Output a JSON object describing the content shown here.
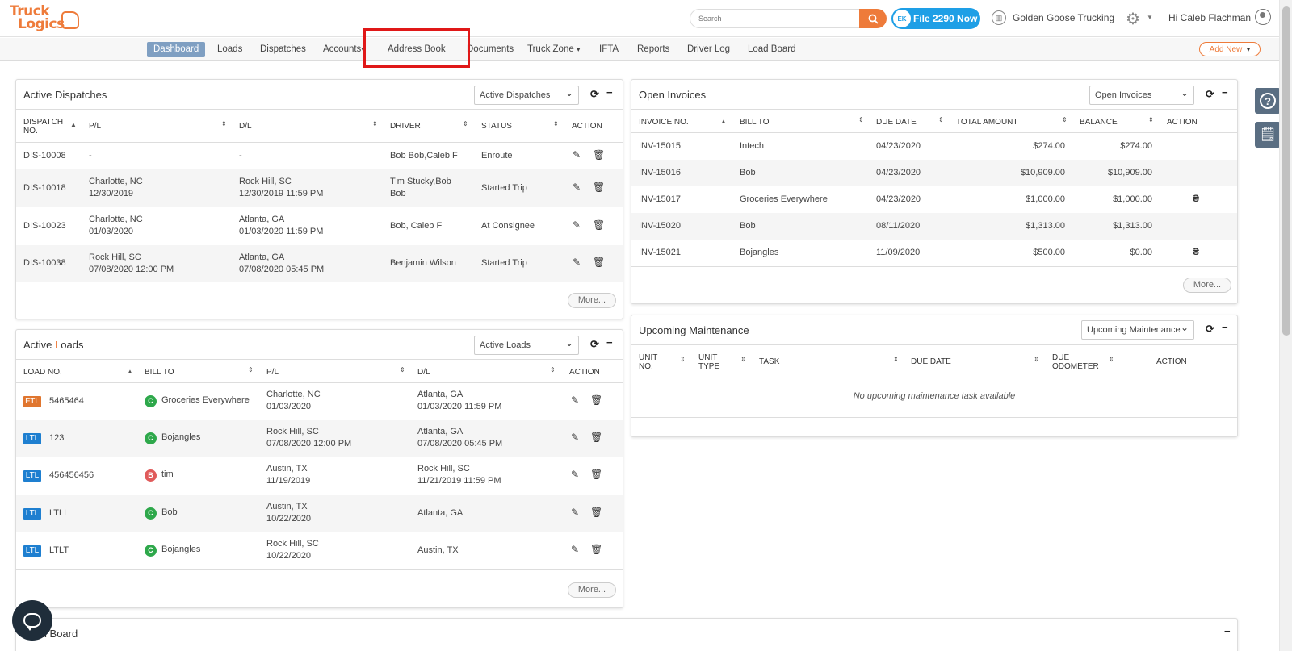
{
  "header": {
    "logo_line1": "Truck",
    "logo_line2": "Logics",
    "search_placeholder": "Search",
    "file_badge": "EK",
    "file_button": "File 2290 Now",
    "company": "Golden Goose Trucking",
    "greeting": "Hi Caleb Flachman"
  },
  "nav": {
    "items": [
      "Dashboard",
      "Loads",
      "Dispatches",
      "Accounts",
      "Address Book",
      "Documents",
      "Truck Zone",
      "IFTA",
      "Reports",
      "Driver Log",
      "Load Board"
    ],
    "accounts_caret": "▾",
    "truckzone_caret": "▾",
    "add_new": "Add New",
    "add_new_caret": "▾"
  },
  "dispatches": {
    "title": "Active Dispatches",
    "select": "Active Dispatches",
    "columns": [
      "DISPATCH",
      "NO.",
      "P/L",
      "D/L",
      "DRIVER",
      "STATUS",
      "ACTION"
    ],
    "rows": [
      {
        "no": "DIS-10008",
        "pl1": "-",
        "pl2": "",
        "dl1": "-",
        "dl2": "",
        "driver1": "Bob Bob,Caleb F",
        "driver2": "",
        "status": "Enroute"
      },
      {
        "no": "DIS-10018",
        "pl1": "Charlotte, NC",
        "pl2": "12/30/2019",
        "dl1": "Rock Hill, SC",
        "dl2": "12/30/2019 11:59 PM",
        "driver1": "Tim Stucky,Bob",
        "driver2": "Bob",
        "status": "Started Trip"
      },
      {
        "no": "DIS-10023",
        "pl1": "Charlotte, NC",
        "pl2": "01/03/2020",
        "dl1": "Atlanta, GA",
        "dl2": "01/03/2020 11:59 PM",
        "driver1": "Bob, Caleb F",
        "driver2": "",
        "status": "At Consignee"
      },
      {
        "no": "DIS-10038",
        "pl1": "Rock Hill, SC",
        "pl2": "07/08/2020 12:00 PM",
        "dl1": "Atlanta, GA",
        "dl2": "07/08/2020 05:45 PM",
        "driver1": "Benjamin Wilson",
        "driver2": "",
        "status": "Started Trip"
      }
    ],
    "more": "More..."
  },
  "loads": {
    "title_a": "Active ",
    "title_b": "L",
    "title_c": "oads",
    "select": "Active Loads",
    "columns": [
      "LOAD NO.",
      "BILL TO",
      "P/L",
      "D/L",
      "ACTION"
    ],
    "rows": [
      {
        "type": "FTL",
        "no": "5465464",
        "badge": "C",
        "bill": "Groceries Everywhere",
        "pl1": "Charlotte, NC",
        "pl2": "01/03/2020",
        "dl1": "Atlanta, GA",
        "dl2": "01/03/2020 11:59 PM"
      },
      {
        "type": "LTL",
        "no": "123",
        "badge": "C",
        "bill": "Bojangles",
        "pl1": "Rock Hill, SC",
        "pl2": "07/08/2020 12:00 PM",
        "dl1": "Atlanta, GA",
        "dl2": "07/08/2020 05:45 PM"
      },
      {
        "type": "LTL",
        "no": "456456456",
        "badge": "B",
        "bill": "tim",
        "pl1": "Austin, TX",
        "pl2": "11/19/2019",
        "dl1": "Rock Hill, SC",
        "dl2": "11/21/2019 11:59 PM"
      },
      {
        "type": "LTL",
        "no": "LTLL",
        "badge": "C",
        "bill": "Bob",
        "pl1": "Austin, TX",
        "pl2": "10/22/2020",
        "dl1": "Atlanta, GA",
        "dl2": ""
      },
      {
        "type": "LTL",
        "no": "LTLT",
        "badge": "C",
        "bill": "Bojangles",
        "pl1": "Rock Hill, SC",
        "pl2": "10/22/2020",
        "dl1": "Austin, TX",
        "dl2": ""
      }
    ],
    "more": "More..."
  },
  "invoices": {
    "title": "Open Invoices",
    "select": "Open Invoices",
    "columns": [
      "INVOICE NO.",
      "BILL TO",
      "DUE DATE",
      "TOTAL AMOUNT",
      "BALANCE",
      "ACTION"
    ],
    "rows": [
      {
        "no": "INV-15015",
        "bill": "Intech",
        "due": "04/23/2020",
        "total": "$274.00",
        "balance": "$274.00",
        "action": ""
      },
      {
        "no": "INV-15016",
        "bill": "Bob",
        "due": "04/23/2020",
        "total": "$10,909.00",
        "balance": "$10,909.00",
        "action": ""
      },
      {
        "no": "INV-15017",
        "bill": "Groceries Everywhere",
        "due": "04/23/2020",
        "total": "$1,000.00",
        "balance": "$1,000.00",
        "action": "payment-icon"
      },
      {
        "no": "INV-15020",
        "bill": "Bob",
        "due": "08/11/2020",
        "total": "$1,313.00",
        "balance": "$1,313.00",
        "action": ""
      },
      {
        "no": "INV-15021",
        "bill": "Bojangles",
        "due": "11/09/2020",
        "total": "$500.00",
        "balance": "$0.00",
        "action": "payment-icon"
      }
    ],
    "more": "More..."
  },
  "maintenance": {
    "title": "Upcoming Maintenance",
    "select": "Upcoming Maintenance",
    "col_unit_a": "UNIT",
    "col_unit_b": "NO.",
    "col_type_a": "UNIT",
    "col_type_b": "TYPE",
    "col_task": "TASK",
    "col_due": "DUE DATE",
    "col_odo_a": "DUE",
    "col_odo_b": "ODOMETER",
    "col_action": "ACTION",
    "empty": "No upcoming maintenance task available"
  },
  "loadboard": {
    "title": "Load Board"
  },
  "colors": {
    "brand": "#ee7b3a",
    "nav_active": "#7f9fc2",
    "file_btn": "#1e9fe6",
    "highlight": "#e01818"
  }
}
